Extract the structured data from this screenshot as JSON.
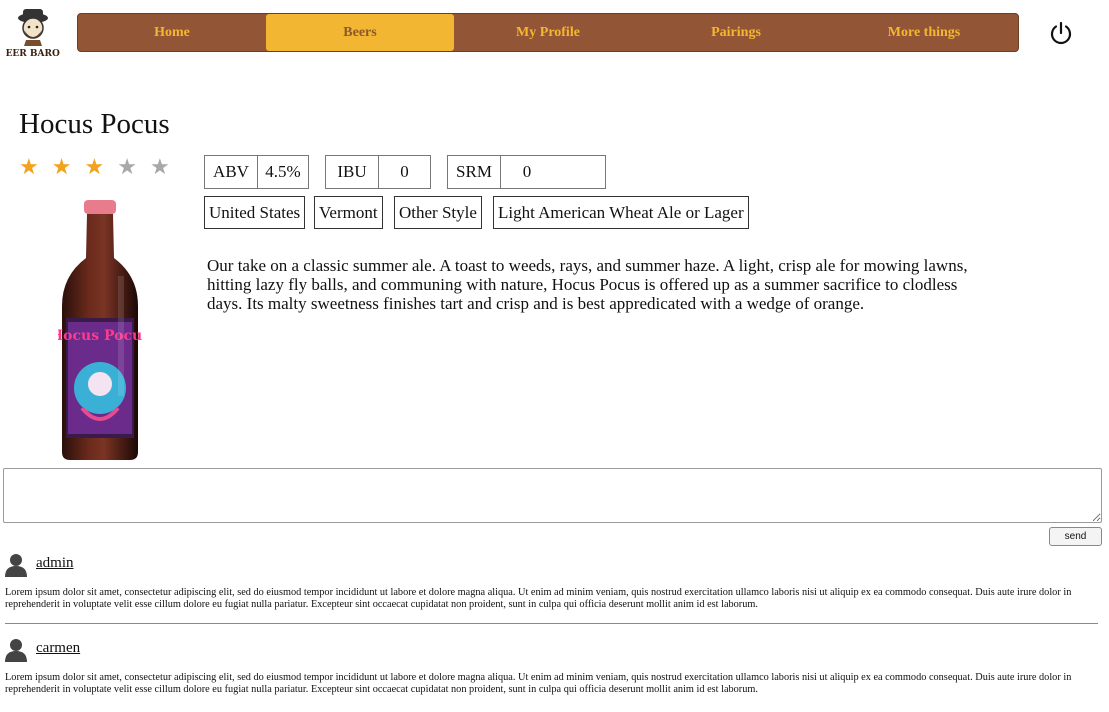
{
  "logo": {
    "text": "BEER BARON"
  },
  "nav": {
    "items": [
      {
        "label": "Home",
        "active": false
      },
      {
        "label": "Beers",
        "active": true
      },
      {
        "label": "My Profile",
        "active": false
      },
      {
        "label": "Pairings",
        "active": false
      },
      {
        "label": "More things",
        "active": false
      }
    ],
    "power_icon": "power-icon"
  },
  "beer": {
    "name": "Hocus Pocus",
    "rating": 3,
    "rating_max": 5,
    "stats": {
      "abv_label": "ABV",
      "abv_value": "4.5%",
      "ibu_label": "IBU",
      "ibu_value": "0",
      "srm_label": "SRM",
      "srm_value": "0"
    },
    "tags": {
      "country": "United States",
      "state": "Vermont",
      "style": "Other Style",
      "category": "Light American Wheat Ale or Lager"
    },
    "description": "Our take on a classic summer ale. A toast to weeds, rays, and summer haze. A light, crisp ale for mowing lawns, hitting lazy fly balls, and communing with nature, Hocus Pocus is offered up as a summer sacrifice to clodless days. Its malty sweetness finishes tart and crisp and is best appredicated with a wedge of orange.",
    "label_text": "Hocus Pocus"
  },
  "comment_form": {
    "value": "",
    "send_label": "send"
  },
  "comments": [
    {
      "user": "admin",
      "text": "Lorem ipsum dolor sit amet, consectetur adipiscing elit, sed do eiusmod tempor incididunt ut labore et dolore magna aliqua. Ut enim ad minim veniam, quis nostrud exercitation ullamco laboris nisi ut aliquip ex ea commodo consequat. Duis aute irure dolor in reprehenderit in voluptate velit esse cillum dolore eu fugiat nulla pariatur. Excepteur sint occaecat cupidatat non proident, sunt in culpa qui officia deserunt mollit anim id est laborum."
    },
    {
      "user": "carmen",
      "text": "Lorem ipsum dolor sit amet, consectetur adipiscing elit, sed do eiusmod tempor incididunt ut labore et dolore magna aliqua. Ut enim ad minim veniam, quis nostrud exercitation ullamco laboris nisi ut aliquip ex ea commodo consequat. Duis aute irure dolor in reprehenderit in voluptate velit esse cillum dolore eu fugiat nulla pariatur. Excepteur sint occaecat cupidatat non proident, sunt in culpa qui officia deserunt mollit anim id est laborum."
    }
  ]
}
